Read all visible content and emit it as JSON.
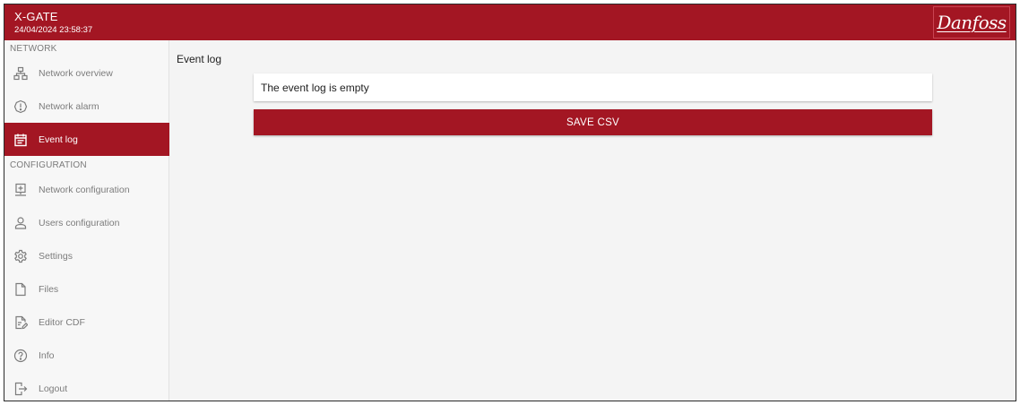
{
  "header": {
    "title": "X-GATE",
    "datetime": "24/04/2024 23:58:37",
    "logo_text": "Danfoss"
  },
  "sidebar": {
    "sections": {
      "network": "NETWORK",
      "configuration": "CONFIGURATION"
    },
    "items": [
      {
        "label": "Network overview",
        "icon": "network-icon"
      },
      {
        "label": "Network alarm",
        "icon": "alarm-icon"
      },
      {
        "label": "Event log",
        "icon": "event-log-icon",
        "active": true
      },
      {
        "label": "Network configuration",
        "icon": "network-config-icon"
      },
      {
        "label": "Users configuration",
        "icon": "user-icon"
      },
      {
        "label": "Settings",
        "icon": "gear-icon"
      },
      {
        "label": "Files",
        "icon": "file-icon"
      },
      {
        "label": "Editor CDF",
        "icon": "edit-file-icon"
      },
      {
        "label": "Info",
        "icon": "help-icon"
      },
      {
        "label": "Logout",
        "icon": "logout-icon"
      }
    ]
  },
  "main": {
    "title": "Event log",
    "empty_message": "The event log is empty",
    "save_label": "SAVE CSV"
  },
  "colors": {
    "brand": "#a31623",
    "background": "#f4f4f4",
    "sidebar_text": "#7c7c7c"
  }
}
